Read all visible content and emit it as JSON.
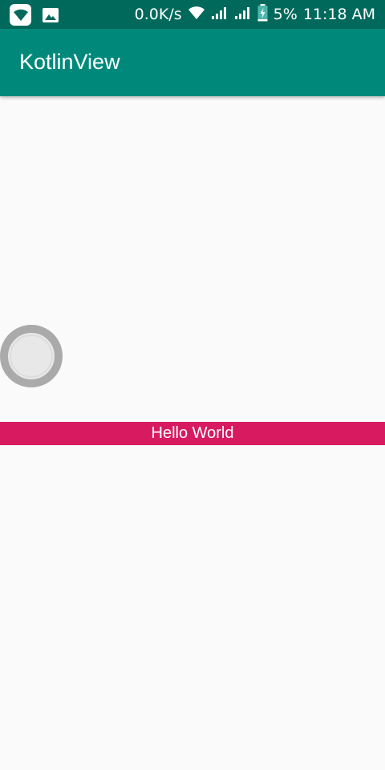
{
  "status_bar": {
    "network_speed": "0.0K/s",
    "battery_percent": "5%",
    "time": "11:18 AM",
    "icons": [
      "wifi-notification-icon",
      "image-notification-icon",
      "wifi-icon",
      "signal-icon",
      "signal-icon",
      "battery-charging-icon"
    ]
  },
  "app_bar": {
    "title": "KotlinView"
  },
  "main": {
    "label": "Hello World"
  },
  "colors": {
    "status_bar": "#00695c",
    "app_bar": "#00897b",
    "label_background": "#d81b60",
    "ring_outer": "#aaaaaa",
    "ring_inner": "#e8e8e8",
    "background": "#fafafa"
  }
}
